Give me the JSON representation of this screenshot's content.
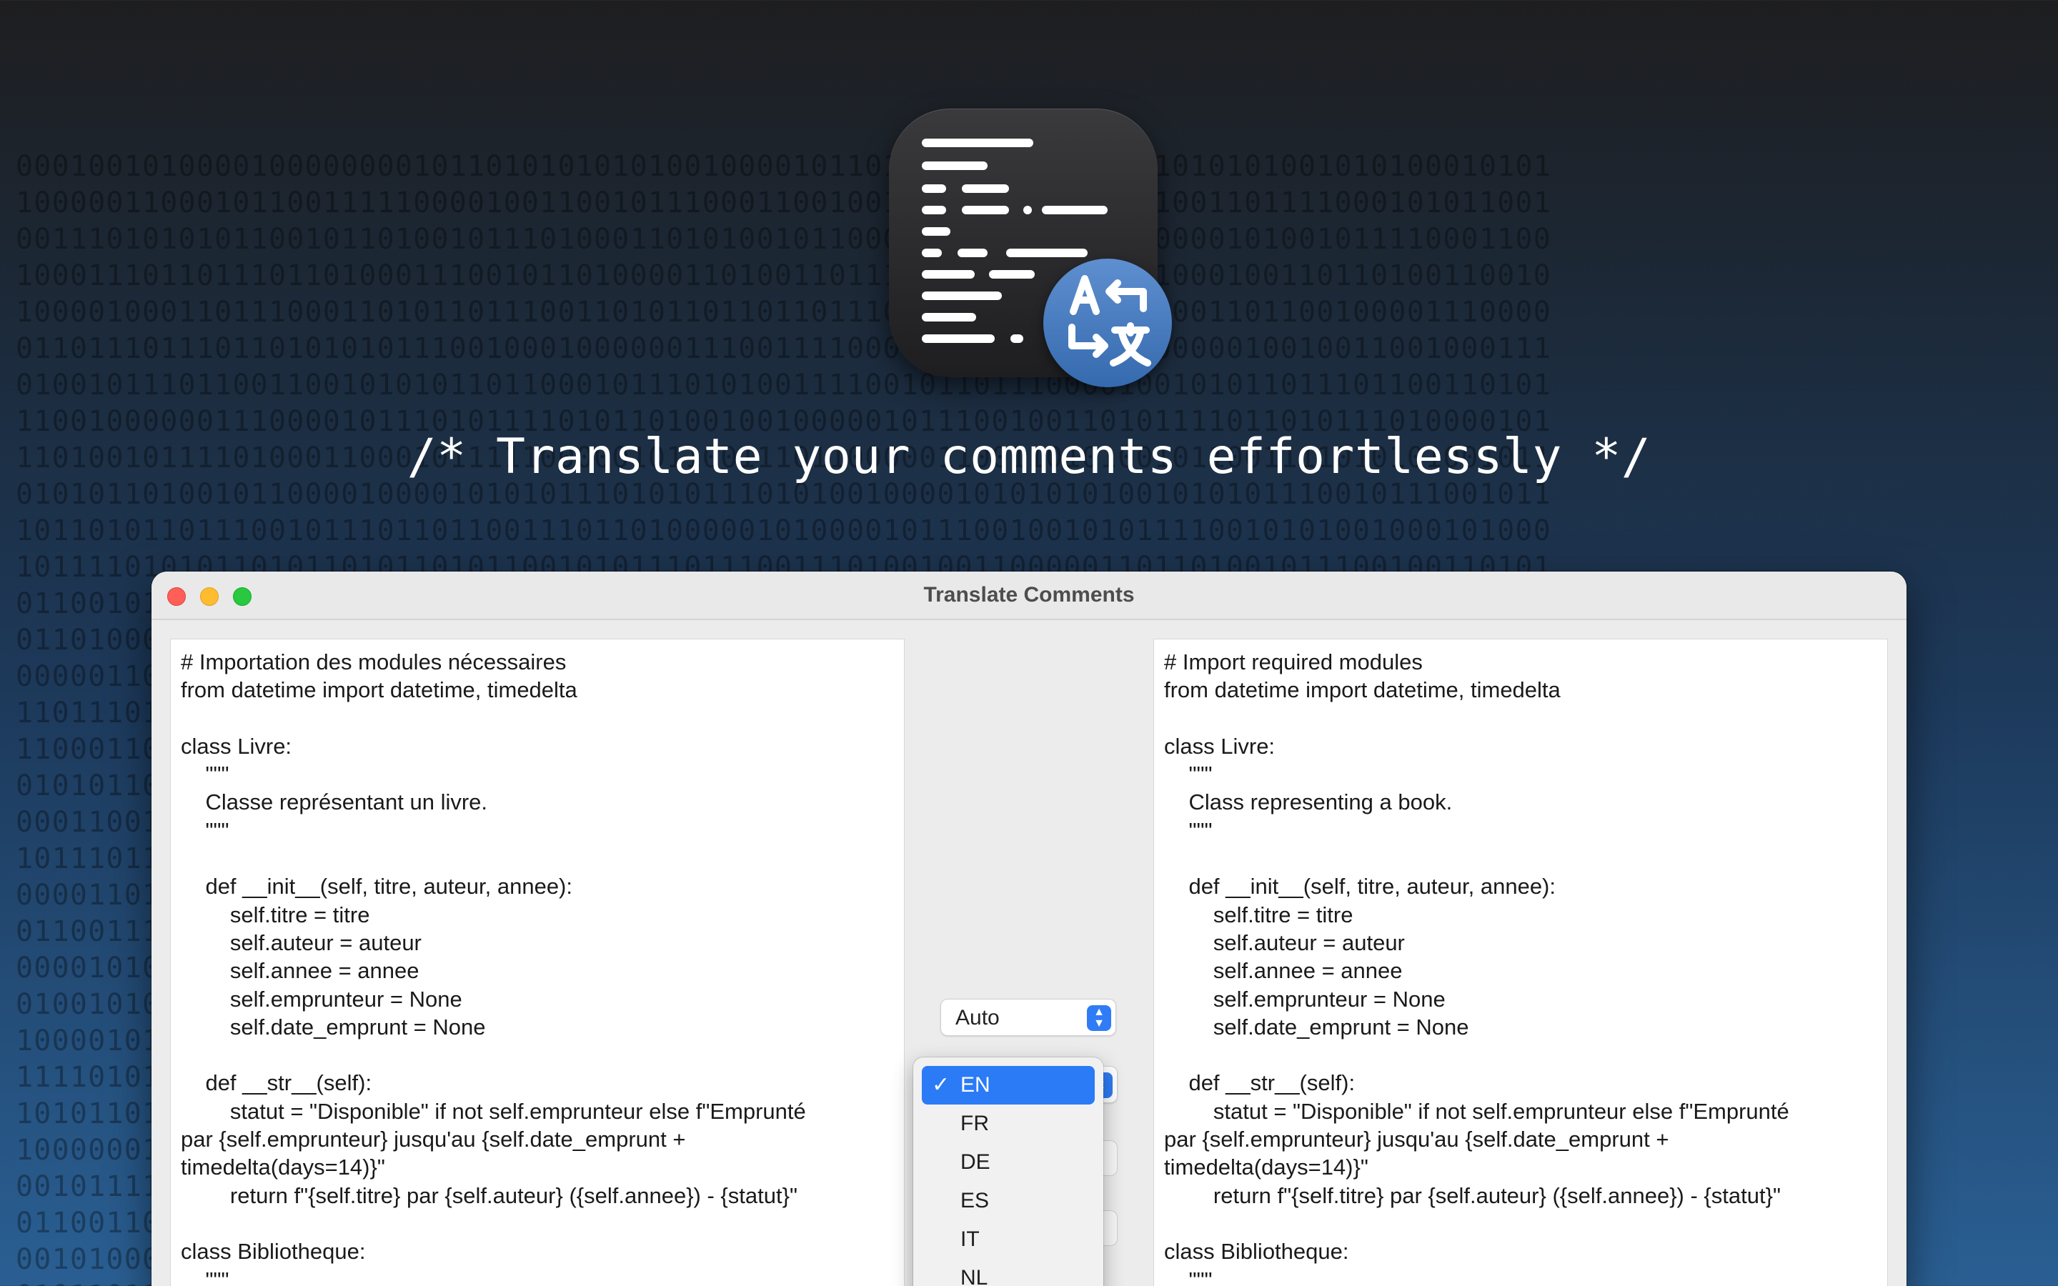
{
  "tagline": "/* Translate your comments effortlessly */",
  "window": {
    "title": "Translate Comments"
  },
  "left_text": "# Importation des modules nécessaires\nfrom datetime import datetime, timedelta\n\nclass Livre:\n    \"\"\"\n    Classe représentant un livre.\n    \"\"\"\n\n    def __init__(self, titre, auteur, annee):\n        self.titre = titre\n        self.auteur = auteur\n        self.annee = annee\n        self.emprunteur = None\n        self.date_emprunt = None\n\n    def __str__(self):\n        statut = \"Disponible\" if not self.emprunteur else f\"Emprunté\npar {self.emprunteur} jusqu'au {self.date_emprunt +\ntimedelta(days=14)}\"\n        return f\"{self.titre} par {self.auteur} ({self.annee}) - {statut}\"\n\nclass Bibliotheque:\n    \"\"\"",
  "right_text": "# Import required modules\nfrom datetime import datetime, timedelta\n\nclass Livre:\n    \"\"\"\n    Class representing a book.\n    \"\"\"\n\n    def __init__(self, titre, auteur, annee):\n        self.titre = titre\n        self.auteur = auteur\n        self.annee = annee\n        self.emprunteur = None\n        self.date_emprunt = None\n\n    def __str__(self):\n        statut = \"Disponible\" if not self.emprunteur else f\"Emprunté\npar {self.emprunteur} jusqu'au {self.date_emprunt +\ntimedelta(days=14)}\"\n        return f\"{self.titre} par {self.auteur} ({self.annee}) - {statut}\"\n\nclass Bibliotheque:\n    \"\"\"",
  "source_language": {
    "value": "Auto"
  },
  "target_menu": {
    "check": "✓",
    "items": [
      "EN",
      "FR",
      "DE",
      "ES",
      "IT",
      "NL"
    ],
    "selected": "EN"
  },
  "colors": {
    "accent": "#2b7bf7",
    "badge": "#356aae"
  },
  "icons": [
    "app-code-icon",
    "translate-icon",
    "updown-chevron-icon",
    "checkmark-icon"
  ]
}
